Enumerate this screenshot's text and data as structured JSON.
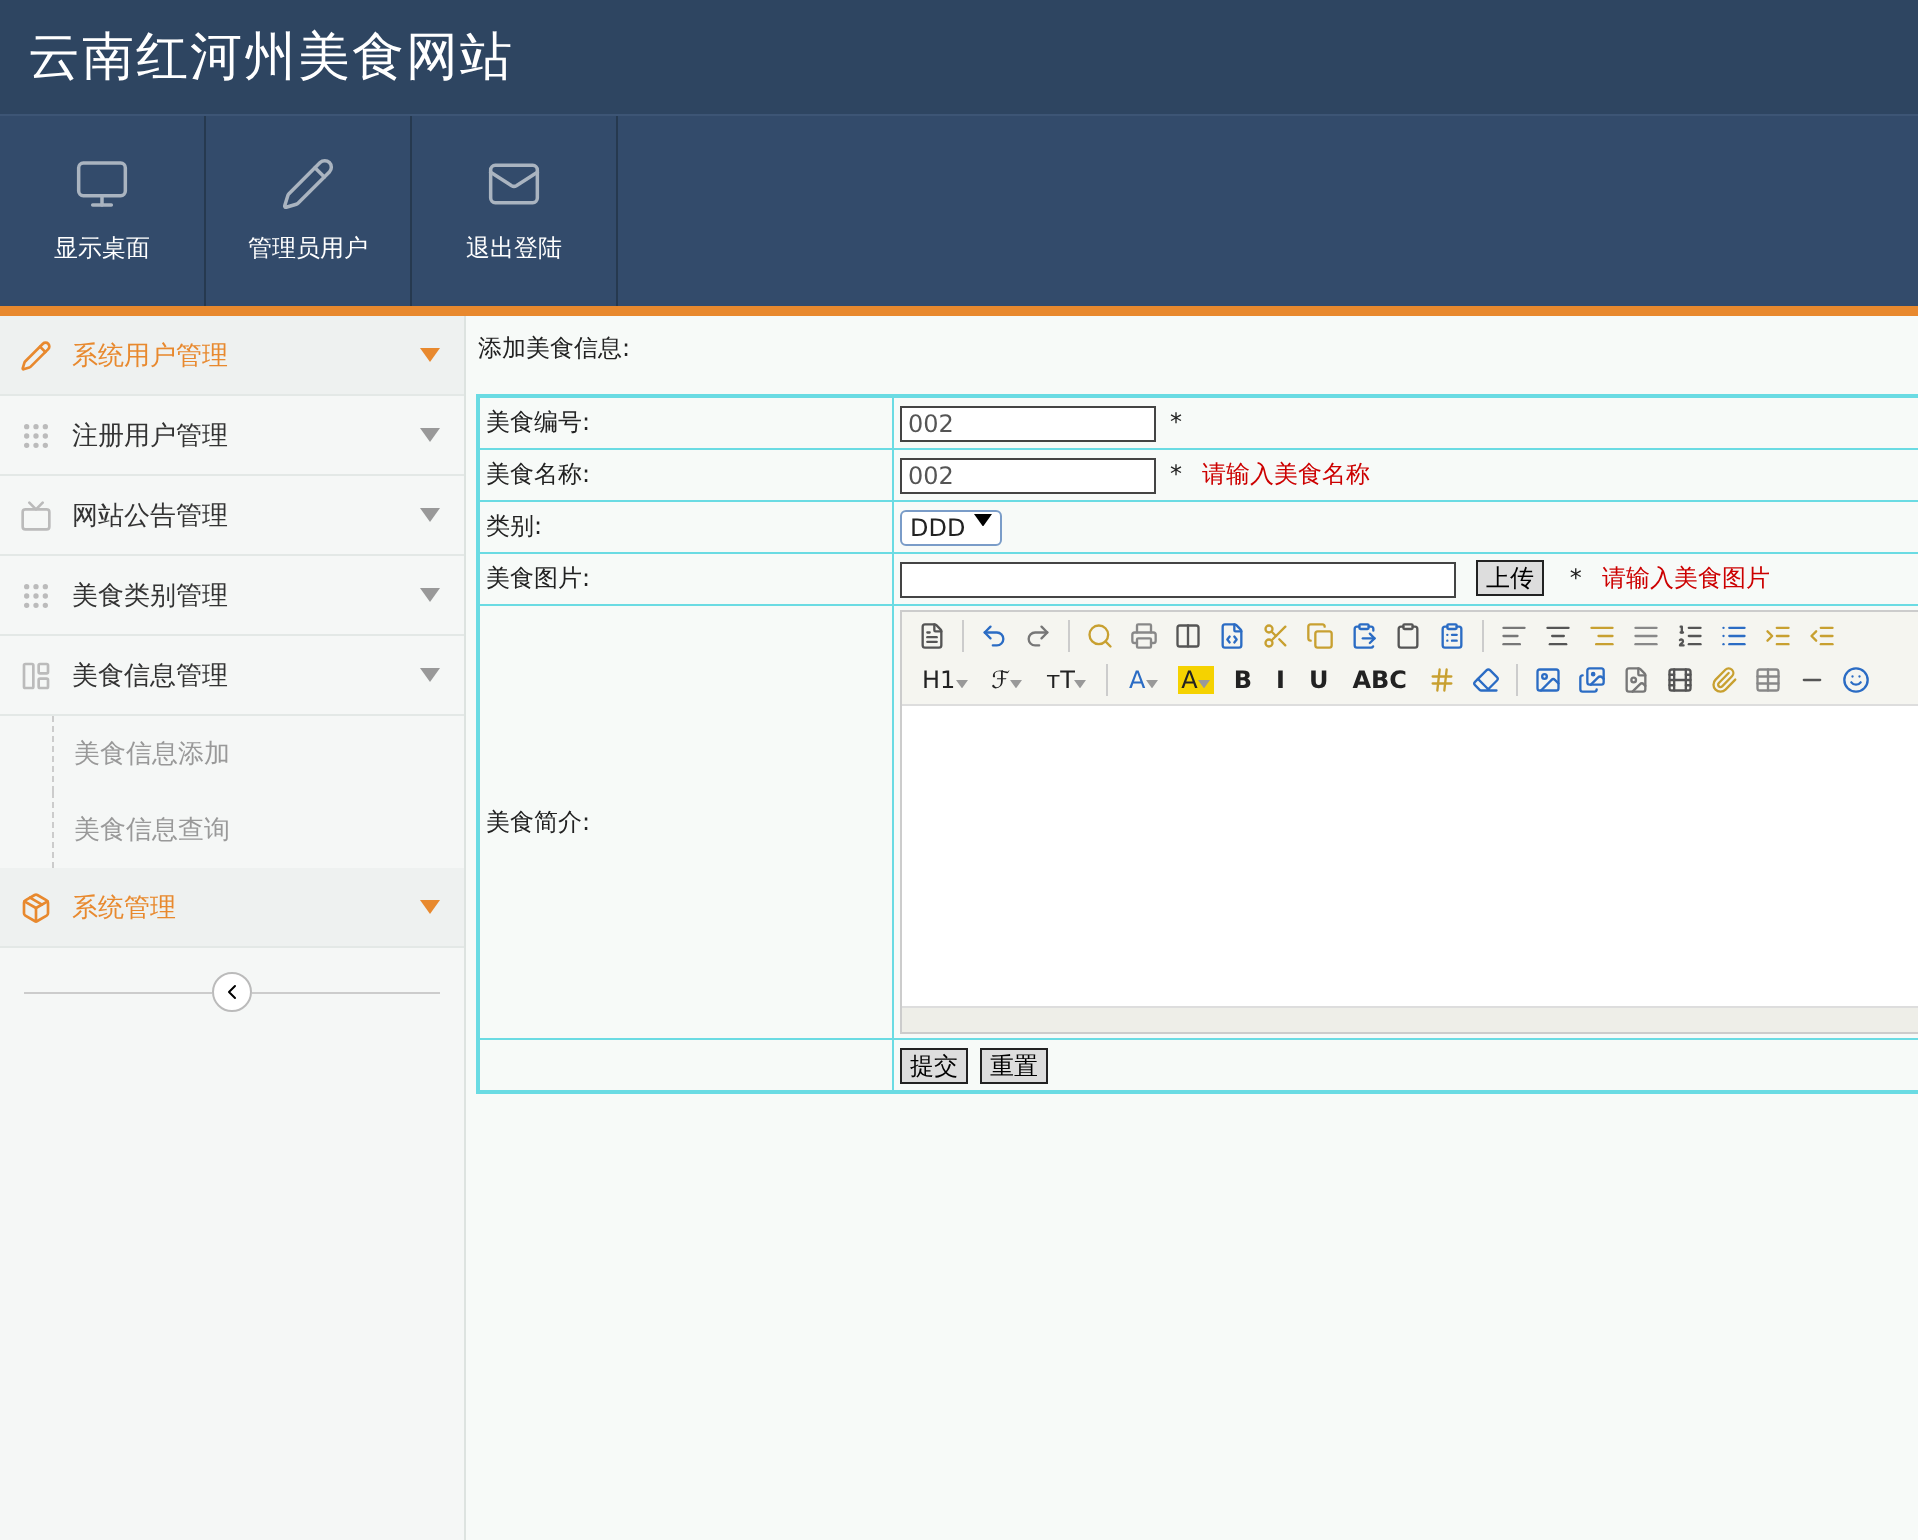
{
  "site_title": "云南红河州美食网站",
  "top_nav": [
    {
      "label": "显示桌面",
      "kind": "monitor"
    },
    {
      "label": "管理员用户",
      "kind": "pencil"
    },
    {
      "label": "退出登陆",
      "kind": "mail"
    }
  ],
  "sidebar": {
    "items": [
      {
        "label": "系统用户管理",
        "kind": "pencil",
        "active": true
      },
      {
        "label": "注册用户管理",
        "kind": "grid",
        "active": false
      },
      {
        "label": "网站公告管理",
        "kind": "screen",
        "active": false
      },
      {
        "label": "美食类别管理",
        "kind": "grid",
        "active": false
      },
      {
        "label": "美食信息管理",
        "kind": "layout",
        "active": false,
        "children": [
          {
            "label": "美食信息添加"
          },
          {
            "label": "美食信息查询"
          }
        ]
      },
      {
        "label": "系统管理",
        "kind": "box",
        "active": true
      }
    ]
  },
  "form": {
    "heading": "添加美食信息:",
    "rows": [
      {
        "kind": "input",
        "label": "美食编号:",
        "value": "002",
        "required": "*"
      },
      {
        "kind": "input",
        "label": "美食名称:",
        "value": "002",
        "required": "*",
        "error": "请输入美食名称"
      },
      {
        "kind": "select",
        "label": "类别:",
        "value": "DDD"
      },
      {
        "kind": "upload",
        "label": "美食图片:",
        "button": "上传",
        "required": "*",
        "error": "请输入美食图片"
      },
      {
        "kind": "editor",
        "label": "美食简介:"
      }
    ],
    "editor_toolbar": [
      [
        {
          "kind": "icon"
        },
        {
          "kind": "sep"
        },
        {
          "kind": "icon"
        },
        {
          "kind": "icon"
        },
        {
          "kind": "sep"
        },
        {
          "kind": "icon"
        },
        {
          "kind": "icon"
        },
        {
          "kind": "icon"
        },
        {
          "kind": "icon"
        },
        {
          "kind": "icon"
        },
        {
          "kind": "icon"
        },
        {
          "kind": "icon"
        },
        {
          "kind": "icon"
        },
        {
          "kind": "icon"
        },
        {
          "kind": "sep"
        },
        {
          "kind": "icon"
        },
        {
          "kind": "icon"
        },
        {
          "kind": "icon"
        },
        {
          "kind": "icon"
        },
        {
          "kind": "icon"
        },
        {
          "kind": "icon"
        },
        {
          "kind": "icon"
        },
        {
          "kind": "icon"
        }
      ],
      [
        {
          "kind": "text",
          "text": "H1",
          "dropdown": true
        },
        {
          "kind": "text",
          "text": "ℱ",
          "dropdown": true
        },
        {
          "kind": "text",
          "text": "тT",
          "dropdown": true
        },
        {
          "kind": "sep"
        },
        {
          "kind": "text",
          "text": "A",
          "dropdown": true
        },
        {
          "kind": "highlight",
          "text": "A",
          "dropdown": true
        },
        {
          "kind": "text",
          "text": "B",
          "dropdown": false
        },
        {
          "kind": "text",
          "text": "I",
          "dropdown": false
        },
        {
          "kind": "text",
          "text": "U",
          "dropdown": false
        },
        {
          "kind": "text",
          "text": "ABC",
          "dropdown": false
        },
        {
          "kind": "icon"
        },
        {
          "kind": "icon"
        },
        {
          "kind": "sep"
        },
        {
          "kind": "icon"
        },
        {
          "kind": "icon"
        },
        {
          "kind": "icon"
        },
        {
          "kind": "icon"
        },
        {
          "kind": "icon"
        },
        {
          "kind": "icon"
        },
        {
          "kind": "icon"
        },
        {
          "kind": "icon"
        }
      ]
    ],
    "buttons": [
      "提交",
      "重置"
    ]
  }
}
